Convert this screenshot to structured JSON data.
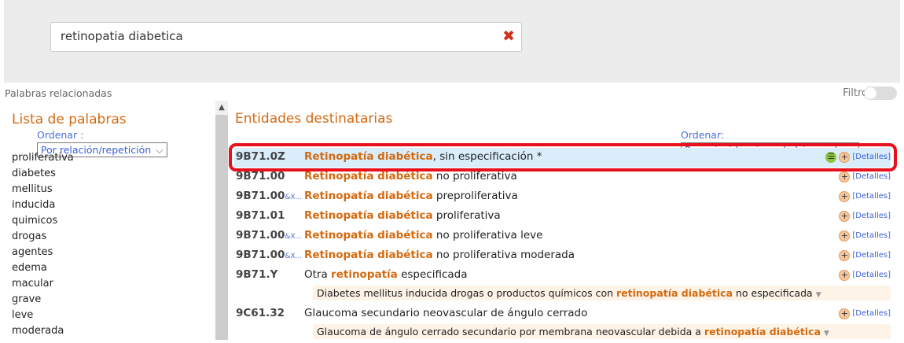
{
  "search": {
    "value": "retinopatia diabetica",
    "clear_icon": "close-x-icon"
  },
  "related_label": "Palabras relacionadas",
  "filter": {
    "label": "Filtro",
    "enabled": false
  },
  "left": {
    "title": "Lista de palabras",
    "order_label": "Ordenar :",
    "order_value": "Por relación/repetición",
    "words": [
      "proliferativa",
      "diabetes",
      "mellitus",
      "inducida",
      "quimicos",
      "drogas",
      "agentes",
      "edema",
      "macular",
      "grave",
      "leve",
      "moderada"
    ]
  },
  "right": {
    "title": "Entidades destinatarias",
    "order_label": "Ordenar:",
    "order_value": "Por coincidencia en la búsqueda",
    "details_label": "[Detalles]",
    "rows": [
      {
        "code": "9B71.0Z",
        "code_suffix": "",
        "hl": "Retinopatía diabética",
        "rest": ", sin especificación  *",
        "selected": true
      },
      {
        "code": "9B71.00",
        "code_suffix": "",
        "hl": "Retinopatía diabética",
        "rest": " no proliferativa"
      },
      {
        "code": "9B71.00",
        "code_suffix": "&X...",
        "hl": "Retinopatía diabética",
        "rest": " preproliferativa"
      },
      {
        "code": "9B71.01",
        "code_suffix": "",
        "hl": "Retinopatía diabética",
        "rest": " proliferativa"
      },
      {
        "code": "9B71.00",
        "code_suffix": "&X...",
        "hl": "Retinopatía diabética",
        "rest": " no proliferativa leve"
      },
      {
        "code": "9B71.00",
        "code_suffix": "&X...",
        "hl": "Retinopatía diabética",
        "rest": " no proliferativa moderada"
      },
      {
        "code": "9B71.Y",
        "pre": "Otra ",
        "hl": "retinopatía",
        "rest": " especificada",
        "sub": {
          "pre": "Diabetes mellitus inducida drogas o productos químicos con ",
          "hl": "retinopatía diabética",
          "rest": " no especificada"
        }
      },
      {
        "code": "9C61.32",
        "pre": "Glaucoma secundario neovascular de ángulo cerrado",
        "hl": "",
        "rest": "",
        "sub": {
          "pre": "Glaucoma de ángulo cerrado secundario por membrana neovascular debida a ",
          "hl": "retinopatía diabética",
          "rest": ""
        }
      }
    ]
  }
}
